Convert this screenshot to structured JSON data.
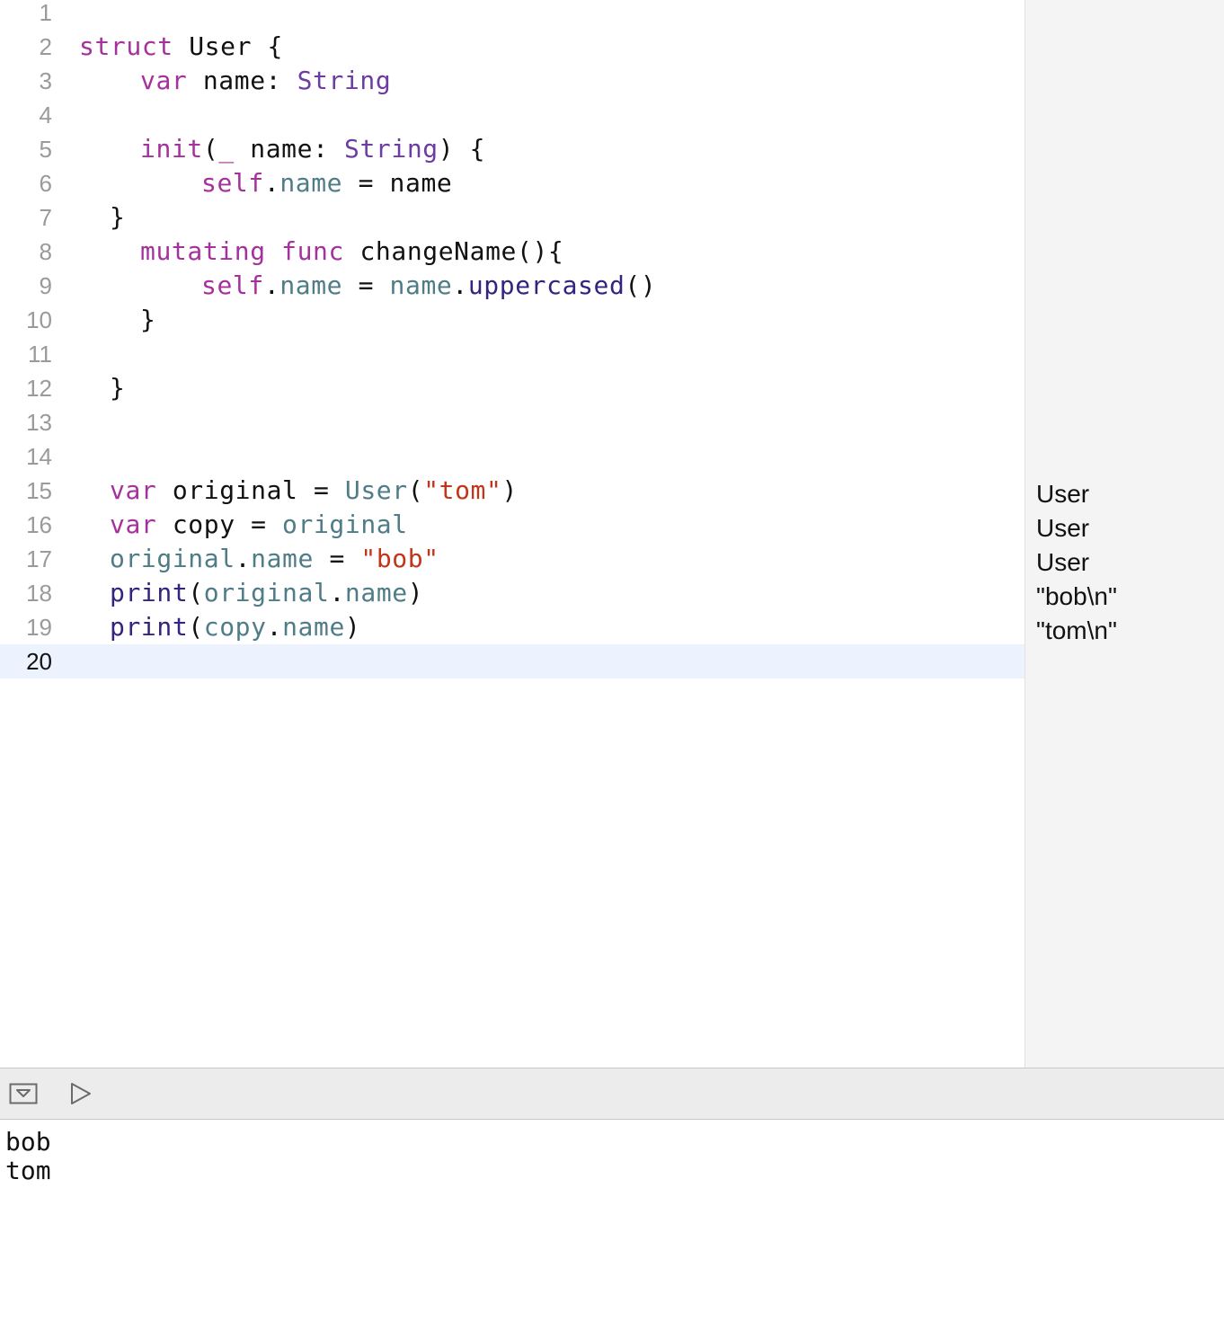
{
  "lines": [
    {
      "n": "1",
      "indent": 0,
      "tokens": []
    },
    {
      "n": "2",
      "indent": 0,
      "tokens": [
        {
          "c": "kw",
          "t": "struct"
        },
        {
          "c": "plain",
          "t": " User {"
        }
      ]
    },
    {
      "n": "3",
      "indent": 2,
      "tokens": [
        {
          "c": "kw",
          "t": "var"
        },
        {
          "c": "plain",
          "t": " name: "
        },
        {
          "c": "ty",
          "t": "String"
        }
      ]
    },
    {
      "n": "4",
      "indent": 0,
      "tokens": []
    },
    {
      "n": "5",
      "indent": 2,
      "tokens": [
        {
          "c": "kw",
          "t": "init"
        },
        {
          "c": "plain",
          "t": "("
        },
        {
          "c": "kw",
          "t": "_"
        },
        {
          "c": "plain",
          "t": " name: "
        },
        {
          "c": "ty",
          "t": "String"
        },
        {
          "c": "plain",
          "t": ") {"
        }
      ]
    },
    {
      "n": "6",
      "indent": 4,
      "tokens": [
        {
          "c": "kw",
          "t": "self"
        },
        {
          "c": "plain",
          "t": "."
        },
        {
          "c": "prop",
          "t": "name"
        },
        {
          "c": "plain",
          "t": " = name"
        }
      ]
    },
    {
      "n": "7",
      "indent": 1,
      "tokens": [
        {
          "c": "plain",
          "t": "}"
        }
      ]
    },
    {
      "n": "8",
      "indent": 2,
      "tokens": [
        {
          "c": "kw",
          "t": "mutating"
        },
        {
          "c": "plain",
          "t": " "
        },
        {
          "c": "kw",
          "t": "func"
        },
        {
          "c": "plain",
          "t": " changeName(){"
        }
      ]
    },
    {
      "n": "9",
      "indent": 4,
      "tokens": [
        {
          "c": "kw",
          "t": "self"
        },
        {
          "c": "plain",
          "t": "."
        },
        {
          "c": "prop",
          "t": "name"
        },
        {
          "c": "plain",
          "t": " = "
        },
        {
          "c": "prop",
          "t": "name"
        },
        {
          "c": "plain",
          "t": "."
        },
        {
          "c": "fn",
          "t": "uppercased"
        },
        {
          "c": "plain",
          "t": "()"
        }
      ]
    },
    {
      "n": "10",
      "indent": 2,
      "tokens": [
        {
          "c": "plain",
          "t": "}"
        }
      ]
    },
    {
      "n": "11",
      "indent": 0,
      "tokens": []
    },
    {
      "n": "12",
      "indent": 1,
      "tokens": [
        {
          "c": "plain",
          "t": "}"
        }
      ]
    },
    {
      "n": "13",
      "indent": 0,
      "tokens": []
    },
    {
      "n": "14",
      "indent": 0,
      "tokens": []
    },
    {
      "n": "15",
      "indent": 1,
      "tokens": [
        {
          "c": "kw",
          "t": "var"
        },
        {
          "c": "plain",
          "t": " original = "
        },
        {
          "c": "prop",
          "t": "User"
        },
        {
          "c": "plain",
          "t": "("
        },
        {
          "c": "str",
          "t": "\"tom\""
        },
        {
          "c": "plain",
          "t": ")"
        }
      ],
      "result": "User"
    },
    {
      "n": "16",
      "indent": 1,
      "tokens": [
        {
          "c": "kw",
          "t": "var"
        },
        {
          "c": "plain",
          "t": " copy = "
        },
        {
          "c": "prop",
          "t": "original"
        }
      ],
      "result": "User"
    },
    {
      "n": "17",
      "indent": 1,
      "tokens": [
        {
          "c": "prop",
          "t": "original"
        },
        {
          "c": "plain",
          "t": "."
        },
        {
          "c": "prop",
          "t": "name"
        },
        {
          "c": "plain",
          "t": " = "
        },
        {
          "c": "str",
          "t": "\"bob\""
        }
      ],
      "result": "User"
    },
    {
      "n": "18",
      "indent": 1,
      "tokens": [
        {
          "c": "fn",
          "t": "print"
        },
        {
          "c": "plain",
          "t": "("
        },
        {
          "c": "prop",
          "t": "original"
        },
        {
          "c": "plain",
          "t": "."
        },
        {
          "c": "prop",
          "t": "name"
        },
        {
          "c": "plain",
          "t": ")"
        }
      ],
      "result": "\"bob\\n\""
    },
    {
      "n": "19",
      "indent": 1,
      "tokens": [
        {
          "c": "fn",
          "t": "print"
        },
        {
          "c": "plain",
          "t": "("
        },
        {
          "c": "prop",
          "t": "copy"
        },
        {
          "c": "plain",
          "t": "."
        },
        {
          "c": "prop",
          "t": "name"
        },
        {
          "c": "plain",
          "t": ")"
        }
      ],
      "result": "\"tom\\n\""
    },
    {
      "n": "20",
      "indent": 0,
      "tokens": [],
      "current": true
    }
  ],
  "console": {
    "output": [
      "bob",
      "tom"
    ]
  },
  "toolbar": {
    "hide_debug_icon": "hide-debug-area-icon",
    "run_icon": "run-playground-icon"
  },
  "colors": {
    "keyword": "#a5319c",
    "type": "#6c3ba4",
    "property": "#4e7c87",
    "function": "#35237f",
    "string": "#c4341a",
    "current_line": "#ecf3fe",
    "results_bg": "#f4f4f4"
  }
}
